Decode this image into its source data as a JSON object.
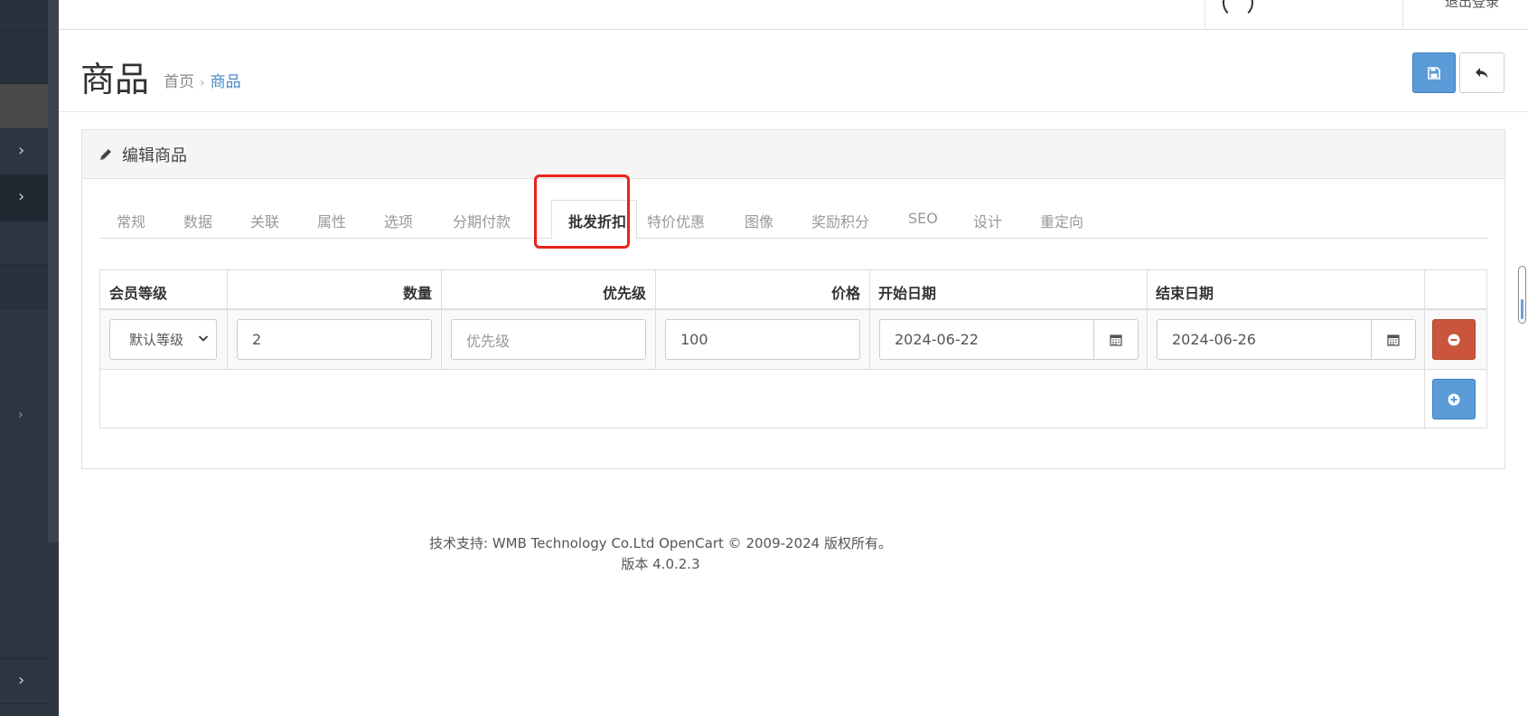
{
  "header": {
    "logout_label": "退出登录"
  },
  "page": {
    "title": "商品",
    "breadcrumb": [
      {
        "label": "首页"
      },
      {
        "label": "商品"
      }
    ]
  },
  "card": {
    "title": "编辑商品",
    "tabs": [
      {
        "label": "常规"
      },
      {
        "label": "数据"
      },
      {
        "label": "关联"
      },
      {
        "label": "属性"
      },
      {
        "label": "选项"
      },
      {
        "label": "分期付款"
      },
      {
        "label": "批发折扣",
        "active": true
      },
      {
        "label": "特价优惠"
      },
      {
        "label": "图像"
      },
      {
        "label": "奖励积分"
      },
      {
        "label": "SEO"
      },
      {
        "label": "设计"
      },
      {
        "label": "重定向"
      }
    ]
  },
  "discount_table": {
    "columns": [
      "会员等级",
      "数量",
      "优先级",
      "价格",
      "开始日期",
      "结束日期"
    ],
    "rows": [
      {
        "customer_group": "默认等级",
        "quantity": "2",
        "priority": "",
        "priority_placeholder": "优先级",
        "price": "100",
        "date_start": "2024-06-22",
        "date_end": "2024-06-26"
      }
    ]
  },
  "footer": {
    "line1": "技术支持: WMB Technology Co.Ltd OpenCart © 2009-2024 版权所有。",
    "line2": "版本 4.0.2.3"
  },
  "colors": {
    "primary": "#5a9bd8",
    "danger": "#c9553d",
    "highlight": "#e8231d",
    "sidebar": "#2d3541"
  },
  "icons": {
    "save": "floppy-disk-icon",
    "back": "reply-icon",
    "edit": "pencil-icon",
    "calendar": "calendar-icon",
    "remove": "minus-circle-icon",
    "add": "plus-circle-icon"
  }
}
